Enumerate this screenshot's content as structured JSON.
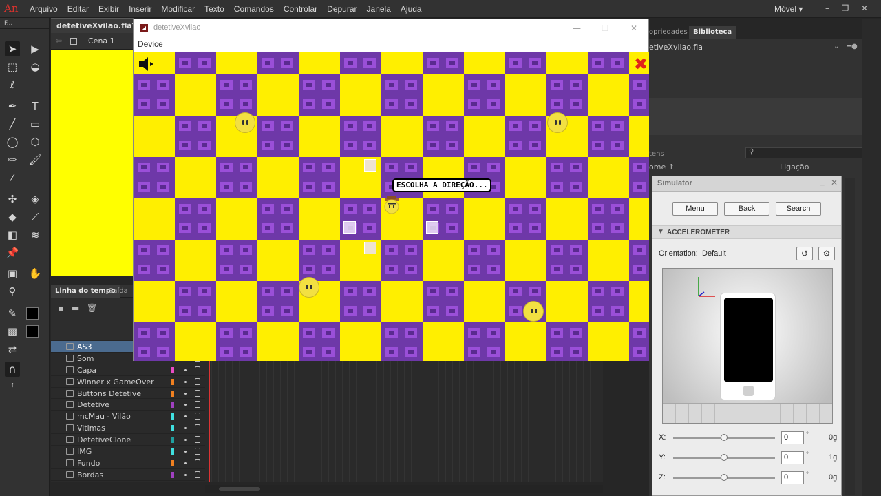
{
  "app": {
    "logo_text": "An",
    "menu": [
      "Arquivo",
      "Editar",
      "Exibir",
      "Inserir",
      "Modificar",
      "Texto",
      "Comandos",
      "Controlar",
      "Depurar",
      "Janela",
      "Ajuda"
    ],
    "workspace": "Móvel ▾"
  },
  "tools": {
    "header": "F..."
  },
  "document": {
    "tab": "detetiveXvilao.fla*",
    "scene": "Cena 1",
    "stage_color": "#ffff00"
  },
  "timeline": {
    "tab_timeline": "Linha do tempo",
    "tab_output": "Saída",
    "layers": [
      {
        "name": "AS3",
        "color": "",
        "selected": true
      },
      {
        "name": "Som",
        "color": ""
      },
      {
        "name": "Capa",
        "color": "#e84cc4"
      },
      {
        "name": "Winner x GameOver",
        "color": "#f08020"
      },
      {
        "name": "Buttons Detetive",
        "color": "#f08020"
      },
      {
        "name": "Detetive",
        "color": "#a040c0"
      },
      {
        "name": "mcMau - Vilão",
        "color": "#40e0e0"
      },
      {
        "name": "Vitimas",
        "color": "#40e0e0"
      },
      {
        "name": "DetetiveClone",
        "color": "#20a0a0"
      },
      {
        "name": "IMG",
        "color": "#40e0e0"
      },
      {
        "name": "Fundo",
        "color": "#f08020"
      },
      {
        "name": "Bordas",
        "color": "#a040c0"
      }
    ]
  },
  "game_window": {
    "title": "detetiveXvilao",
    "menu_device": "Device",
    "speech": "ESCOLHA A DIREÇÃO...",
    "tile_colors": {
      "yellow": "#ffef00",
      "purple": "#6e38a8"
    }
  },
  "right_panel": {
    "tab_props": "opriedades",
    "tab_library": "Biblioteca",
    "library_file": "etiveXvilao.fla",
    "items_label": "tens",
    "col_name": "ome ↑",
    "col_link": "Ligação"
  },
  "simulator": {
    "title": "Simulator",
    "buttons": {
      "menu": "Menu",
      "back": "Back",
      "search": "Search"
    },
    "section": "ACCELEROMETER",
    "orientation_label": "Orientation:",
    "orientation_value": "Default",
    "axes": [
      {
        "label": "X:",
        "value": "0",
        "deg": "°",
        "g": "0g"
      },
      {
        "label": "Y:",
        "value": "0",
        "deg": "°",
        "g": "1g"
      },
      {
        "label": "Z:",
        "value": "0",
        "deg": "°",
        "g": "0g"
      }
    ]
  }
}
